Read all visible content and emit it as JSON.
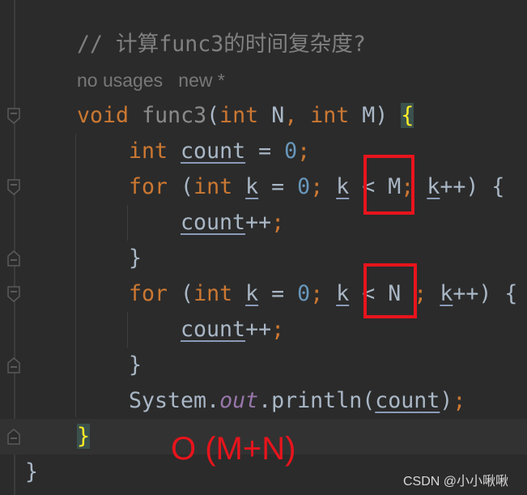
{
  "editor": {
    "lines": [
      {
        "indent": 0,
        "hint": false,
        "tokens": [
          [
            "// 计算func3的时间复杂度?",
            "cm"
          ]
        ]
      },
      {
        "indent": 0,
        "hint": true,
        "tokens": [
          [
            "no usages   new *",
            "hint"
          ]
        ]
      },
      {
        "indent": 0,
        "tokens": [
          [
            "void ",
            "kw"
          ],
          [
            "func3",
            "fn"
          ],
          [
            "(",
            ""
          ],
          [
            "int ",
            "kw"
          ],
          [
            "N",
            ""
          ],
          [
            ", ",
            "kw"
          ],
          [
            "int ",
            "kw"
          ],
          [
            "M) ",
            ""
          ],
          [
            "{",
            "brace"
          ]
        ]
      },
      {
        "indent": 1,
        "tokens": [
          [
            "int ",
            "kw"
          ],
          [
            "count",
            "var"
          ],
          [
            " = ",
            ""
          ],
          [
            "0",
            "num"
          ],
          [
            ";",
            "semi"
          ]
        ]
      },
      {
        "indent": 1,
        "tokens": [
          [
            "for ",
            "kw"
          ],
          [
            "(",
            ""
          ],
          [
            "int ",
            "kw"
          ],
          [
            "k",
            "var"
          ],
          [
            " = ",
            ""
          ],
          [
            "0",
            "num"
          ],
          [
            "; ",
            "semi"
          ],
          [
            "k",
            "var"
          ],
          [
            " < M",
            ""
          ],
          [
            "; ",
            "semi"
          ],
          [
            "k",
            "var"
          ],
          [
            "++) {",
            ""
          ]
        ]
      },
      {
        "indent": 2,
        "tokens": [
          [
            "count",
            "var"
          ],
          [
            "++",
            ""
          ],
          [
            ";",
            "semi"
          ]
        ]
      },
      {
        "indent": 1,
        "tokens": [
          [
            "}",
            ""
          ]
        ]
      },
      {
        "indent": 1,
        "tokens": [
          [
            "for ",
            "kw"
          ],
          [
            "(",
            ""
          ],
          [
            "int ",
            "kw"
          ],
          [
            "k",
            "var"
          ],
          [
            " = ",
            ""
          ],
          [
            "0",
            "num"
          ],
          [
            "; ",
            "semi"
          ],
          [
            "k",
            "var"
          ],
          [
            " < N ",
            ""
          ],
          [
            "; ",
            "semi"
          ],
          [
            "k",
            "var"
          ],
          [
            "++) {",
            ""
          ]
        ]
      },
      {
        "indent": 2,
        "tokens": [
          [
            "count",
            "var"
          ],
          [
            "++",
            ""
          ],
          [
            ";",
            "semi"
          ]
        ]
      },
      {
        "indent": 1,
        "tokens": [
          [
            "}",
            ""
          ]
        ]
      },
      {
        "indent": 1,
        "tokens": [
          [
            "System.",
            ""
          ],
          [
            "out",
            "fld"
          ],
          [
            ".println(",
            ""
          ],
          [
            "count",
            "var"
          ],
          [
            ")",
            ""
          ],
          [
            ";",
            "semi"
          ]
        ]
      },
      {
        "indent": 0,
        "tokens": [
          [
            "}",
            "brace"
          ]
        ]
      },
      {
        "indent": -1,
        "tokens": [
          [
            "}",
            ""
          ]
        ]
      }
    ]
  },
  "annotation": {
    "text": "O (M+N)",
    "color": "#e8141c"
  },
  "watermark": "CSDN @小小啾啾",
  "colors": {
    "background": "#2b2b2b",
    "keyword": "#cc7832",
    "number": "#6897bb",
    "comment": "#808080",
    "field": "#9876aa",
    "brace_match": "#ffef28"
  }
}
